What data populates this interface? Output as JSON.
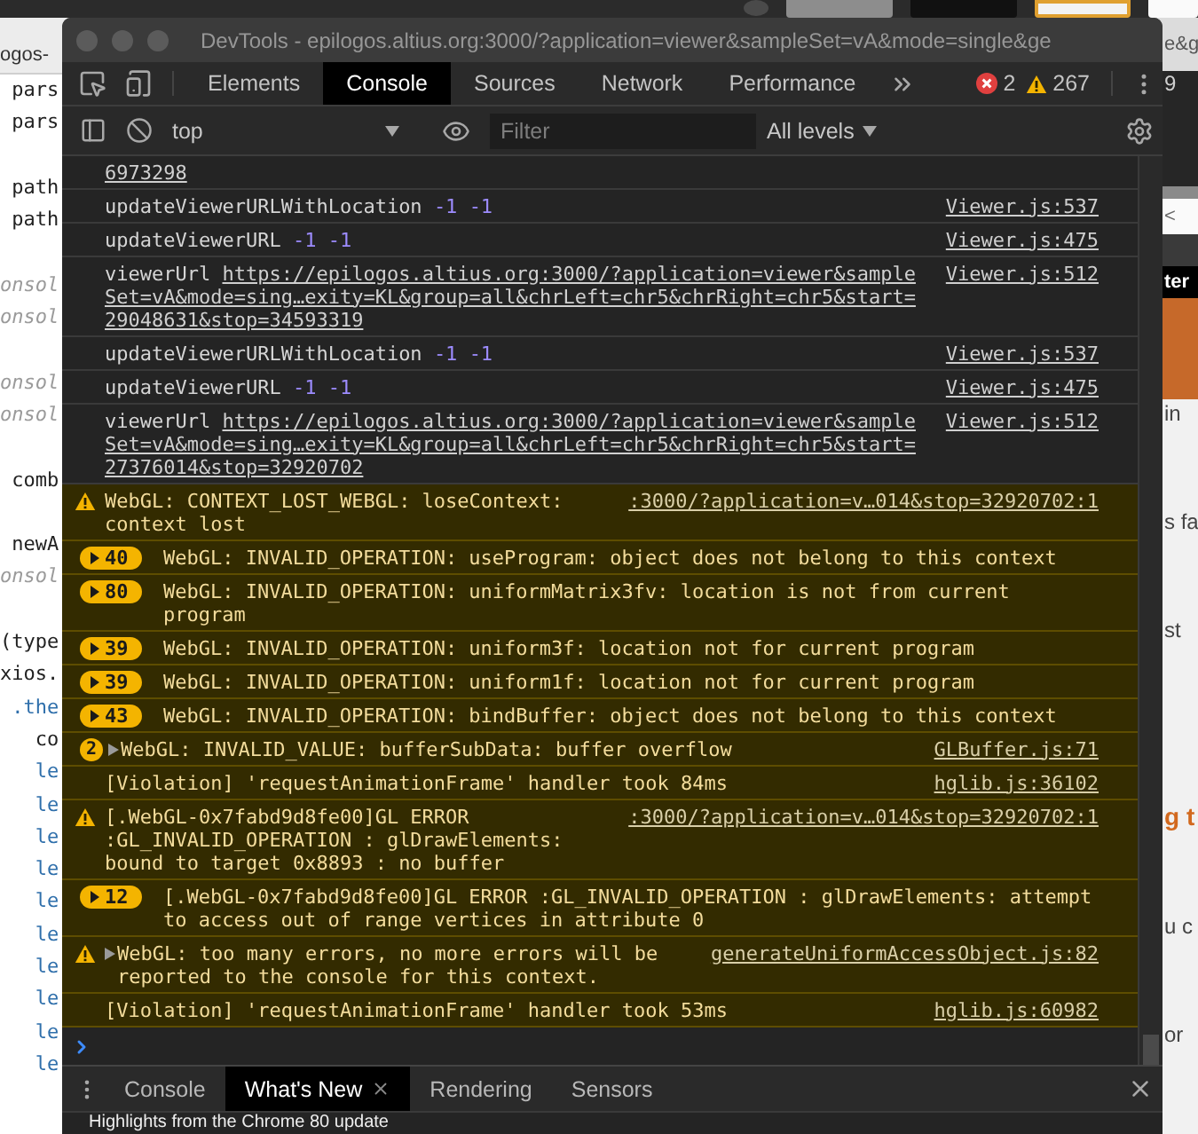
{
  "editor": {
    "tab_label": "ogos-",
    "lines": [
      {
        "kind": "code",
        "text": " pars"
      },
      {
        "kind": "code",
        "text": " pars"
      },
      {
        "kind": "blank"
      },
      {
        "kind": "code",
        "text": " path"
      },
      {
        "kind": "code",
        "text": " path"
      },
      {
        "kind": "blank"
      },
      {
        "kind": "comment",
        "text": "onsol"
      },
      {
        "kind": "comment",
        "text": "onsol"
      },
      {
        "kind": "blank"
      },
      {
        "kind": "comment",
        "text": "onsol"
      },
      {
        "kind": "comment",
        "text": "onsol"
      },
      {
        "kind": "blank"
      },
      {
        "kind": "code",
        "text": " comb"
      },
      {
        "kind": "blank"
      },
      {
        "kind": "code",
        "text": " newA"
      },
      {
        "kind": "comment",
        "text": "onsol"
      },
      {
        "kind": "blank"
      },
      {
        "kind": "code",
        "text": "(type"
      },
      {
        "kind": "code",
        "text": "xios."
      },
      {
        "kind": "method",
        "text": " .the"
      },
      {
        "kind": "code",
        "text": "   co"
      },
      {
        "kind": "keyword",
        "text": "   le"
      },
      {
        "kind": "keyword",
        "text": "   le"
      },
      {
        "kind": "keyword",
        "text": "   le"
      },
      {
        "kind": "keyword",
        "text": "   le"
      },
      {
        "kind": "keyword",
        "text": "   le"
      },
      {
        "kind": "keyword",
        "text": "   le"
      },
      {
        "kind": "keyword",
        "text": "   le"
      },
      {
        "kind": "keyword",
        "text": "   le"
      },
      {
        "kind": "keyword",
        "text": "   le"
      },
      {
        "kind": "keyword",
        "text": "   le"
      }
    ]
  },
  "browser": {
    "address_text": "e&g",
    "counter_text": "9",
    "back_text": "<",
    "nav_text": "ter",
    "page_items": [
      {
        "kind": "text",
        "text": "in"
      },
      {
        "kind": "text",
        "text": "s fa"
      },
      {
        "kind": "text",
        "text": "st"
      },
      {
        "kind": "blank"
      },
      {
        "kind": "heading",
        "text": "g t"
      },
      {
        "kind": "text",
        "text": "u c"
      },
      {
        "kind": "text",
        "text": "or"
      }
    ]
  },
  "devtools": {
    "title": "DevTools - epilogos.altius.org:3000/?application=viewer&sampleSet=vA&mode=single&ge",
    "main_tabs": [
      {
        "label": "Elements",
        "selected": false
      },
      {
        "label": "Console",
        "selected": true
      },
      {
        "label": "Sources",
        "selected": false
      },
      {
        "label": "Network",
        "selected": false
      },
      {
        "label": "Performance",
        "selected": false
      }
    ],
    "error_count": "2",
    "warning_count": "267",
    "toolbar": {
      "context": "top",
      "filter_placeholder": "Filter",
      "levels": "All levels"
    },
    "messages": [
      {
        "kind": "log",
        "expandable": false,
        "parts": [
          {
            "kind": "link",
            "text": "6973298"
          }
        ]
      },
      {
        "kind": "log",
        "expandable": false,
        "parts": [
          {
            "kind": "plain",
            "text": "updateViewerURLWithLocation"
          },
          {
            "kind": "number",
            "text": "-1"
          },
          {
            "kind": "number",
            "text": "-1"
          }
        ],
        "source": "Viewer.js:537"
      },
      {
        "kind": "log",
        "expandable": false,
        "parts": [
          {
            "kind": "plain",
            "text": "updateViewerURL"
          },
          {
            "kind": "number",
            "text": "-1"
          },
          {
            "kind": "number",
            "text": "-1"
          }
        ],
        "source": "Viewer.js:475"
      },
      {
        "kind": "log",
        "expandable": false,
        "parts": [
          {
            "kind": "plain",
            "text": "viewerUrl"
          },
          {
            "kind": "link",
            "text": "https://epilogos.altius.org:3000/?application=viewer&sampleSet=vA&mode=sing…exity=KL&group=all&chrLeft=chr5&chrRight=chr5&start=29048631&stop=34593319"
          }
        ],
        "source": "Viewer.js:512"
      },
      {
        "kind": "log",
        "expandable": false,
        "parts": [
          {
            "kind": "plain",
            "text": "updateViewerURLWithLocation"
          },
          {
            "kind": "number",
            "text": "-1"
          },
          {
            "kind": "number",
            "text": "-1"
          }
        ],
        "source": "Viewer.js:537"
      },
      {
        "kind": "log",
        "expandable": false,
        "parts": [
          {
            "kind": "plain",
            "text": "updateViewerURL"
          },
          {
            "kind": "number",
            "text": "-1"
          },
          {
            "kind": "number",
            "text": "-1"
          }
        ],
        "source": "Viewer.js:475"
      },
      {
        "kind": "log",
        "expandable": false,
        "parts": [
          {
            "kind": "plain",
            "text": "viewerUrl"
          },
          {
            "kind": "link",
            "text": "https://epilogos.altius.org:3000/?application=viewer&sampleSet=vA&mode=sing…exity=KL&group=all&chrLeft=chr5&chrRight=chr5&start=27376014&stop=32920702"
          }
        ],
        "source": "Viewer.js:512"
      },
      {
        "kind": "warning",
        "expandable": false,
        "parts": [
          {
            "kind": "plain",
            "text": "WebGL: CONTEXT_LOST_WEBGL: loseContext: context lost"
          }
        ],
        "source": ":3000/?application=v…014&stop=32920702:1"
      },
      {
        "kind": "warning",
        "expandable": false,
        "badge": {
          "kind": "repeat",
          "count": "40"
        },
        "parts": [
          {
            "kind": "plain",
            "text": "WebGL: INVALID_OPERATION: useProgram: object does not belong to this context"
          }
        ]
      },
      {
        "kind": "warning",
        "expandable": false,
        "badge": {
          "kind": "repeat",
          "count": "80"
        },
        "parts": [
          {
            "kind": "plain",
            "text": "WebGL: INVALID_OPERATION: uniformMatrix3fv: location is not from current program"
          }
        ]
      },
      {
        "kind": "warning",
        "expandable": false,
        "badge": {
          "kind": "repeat",
          "count": "39"
        },
        "parts": [
          {
            "kind": "plain",
            "text": "WebGL: INVALID_OPERATION: uniform3f: location not for current program"
          }
        ]
      },
      {
        "kind": "warning",
        "expandable": false,
        "badge": {
          "kind": "repeat",
          "count": "39"
        },
        "parts": [
          {
            "kind": "plain",
            "text": "WebGL: INVALID_OPERATION: uniform1f: location not for current program"
          }
        ]
      },
      {
        "kind": "warning",
        "expandable": false,
        "badge": {
          "kind": "repeat",
          "count": "43"
        },
        "parts": [
          {
            "kind": "plain",
            "text": "WebGL: INVALID_OPERATION: bindBuffer: object does not belong to this context"
          }
        ]
      },
      {
        "kind": "warning",
        "expandable": true,
        "badge": {
          "kind": "group",
          "count": "2"
        },
        "parts": [
          {
            "kind": "plain",
            "text": "WebGL: INVALID_VALUE: bufferSubData: buffer overflow"
          }
        ],
        "source": "GLBuffer.js:71"
      },
      {
        "kind": "violation",
        "expandable": false,
        "parts": [
          {
            "kind": "plain",
            "text": "[Violation] 'requestAnimationFrame' handler took 84ms"
          }
        ],
        "source": "hglib.js:36102"
      },
      {
        "kind": "warning",
        "expandable": false,
        "parts": [
          {
            "kind": "plain",
            "text": "[.WebGL-0x7fabd9d8fe00]GL ERROR :GL_INVALID_OPERATION : glDrawElements: bound to target 0x8893 : no buffer"
          }
        ],
        "source": ":3000/?application=v…014&stop=32920702:1"
      },
      {
        "kind": "warning",
        "expandable": false,
        "badge": {
          "kind": "repeat",
          "count": "12"
        },
        "parts": [
          {
            "kind": "plain",
            "text": "[.WebGL-0x7fabd9d8fe00]GL ERROR :GL_INVALID_OPERATION : glDrawElements: attempt to access out of range vertices in attribute 0"
          }
        ]
      },
      {
        "kind": "warning",
        "expandable": true,
        "parts": [
          {
            "kind": "plain",
            "text": "WebGL: too many errors, no more errors will be reported to the console for this context."
          }
        ],
        "source": "generateUniformAccessObject.js:82"
      },
      {
        "kind": "violation",
        "expandable": false,
        "parts": [
          {
            "kind": "plain",
            "text": "[Violation] 'requestAnimationFrame' handler took 53ms"
          }
        ],
        "source": "hglib.js:60982"
      }
    ],
    "drawer": {
      "tabs": [
        {
          "label": "Console",
          "selected": false,
          "closable": false
        },
        {
          "label": "What's New",
          "selected": true,
          "closable": true
        },
        {
          "label": "Rendering",
          "selected": false,
          "closable": false
        },
        {
          "label": "Sensors",
          "selected": false,
          "closable": false
        }
      ],
      "content": "Highlights from the Chrome 80 update"
    }
  }
}
